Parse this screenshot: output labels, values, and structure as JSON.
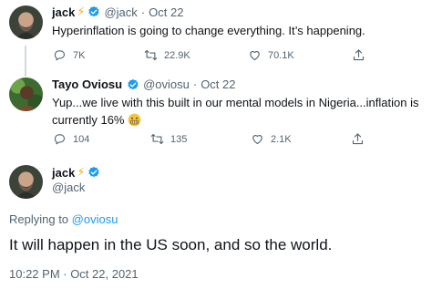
{
  "tweet1": {
    "name": "jack",
    "handle": "@jack",
    "dot": "·",
    "date": "Oct 22",
    "text": "Hyperinflation is going to change everything. It’s happening.",
    "replies": "7K",
    "retweets": "22.9K",
    "likes": "70.1K"
  },
  "tweet2": {
    "name": "Tayo Oviosu",
    "handle": "@oviosu",
    "dot": "·",
    "date": "Oct 22",
    "text_line1": "Yup...we live with this built in our mental models in Nigeria...inflation is",
    "text_line2": "currently 16%",
    "replies": "104",
    "retweets": "135",
    "likes": "2.1K"
  },
  "main": {
    "name": "jack",
    "handle": "@jack",
    "replying_prefix": "Replying to",
    "replying_handle": "@oviosu",
    "text": "It will happen in the US soon, and so the world.",
    "timestamp": "10:22 PM · Oct 22, 2021"
  },
  "colors": {
    "verified": "#1d9bf0",
    "bolt": "#f4b400",
    "link": "#1d9bf0",
    "muted": "#536471"
  },
  "icons": [
    "reply-icon",
    "retweet-icon",
    "like-icon",
    "share-icon",
    "verified-badge-icon",
    "lightning-icon",
    "grimacing-emoji-icon"
  ]
}
